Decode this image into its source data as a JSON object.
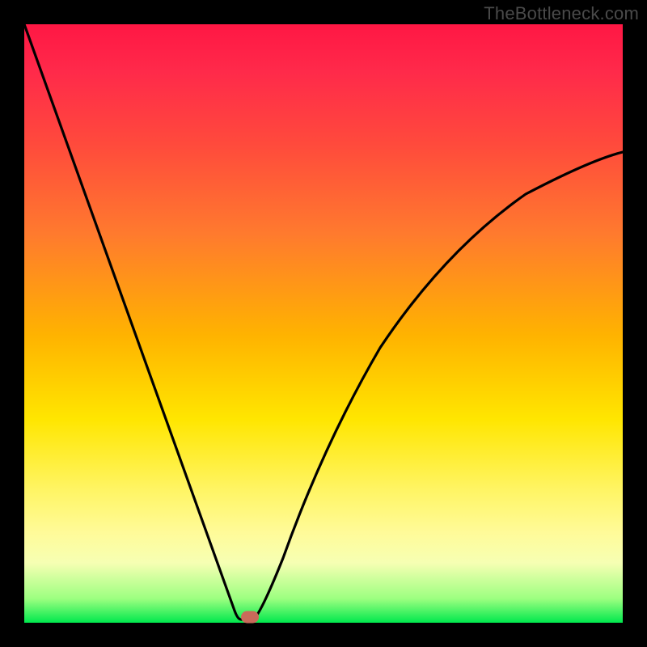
{
  "watermark": "TheBottleneck.com",
  "chart_data": {
    "type": "line",
    "title": "",
    "xlabel": "",
    "ylabel": "",
    "xlim": [
      0,
      100
    ],
    "ylim": [
      0,
      100
    ],
    "x": [
      0,
      5,
      10,
      15,
      20,
      25,
      30,
      33,
      35,
      36,
      37,
      38,
      40,
      45,
      50,
      55,
      60,
      65,
      70,
      75,
      80,
      85,
      90,
      95,
      100
    ],
    "values": [
      100,
      84,
      69,
      54,
      39,
      24,
      9,
      2,
      1,
      0,
      1,
      3,
      8,
      20,
      31,
      40,
      48,
      55,
      60,
      65,
      69,
      72,
      74,
      76,
      78
    ],
    "min_point": {
      "x": 36,
      "y": 0
    },
    "marker": {
      "x": 37,
      "y": 0.5
    },
    "gradient_stops": [
      {
        "pos": 0,
        "color": "#ff1744"
      },
      {
        "pos": 35,
        "color": "#ff7a2e"
      },
      {
        "pos": 66,
        "color": "#ffe600"
      },
      {
        "pos": 100,
        "color": "#00e84d"
      }
    ]
  }
}
